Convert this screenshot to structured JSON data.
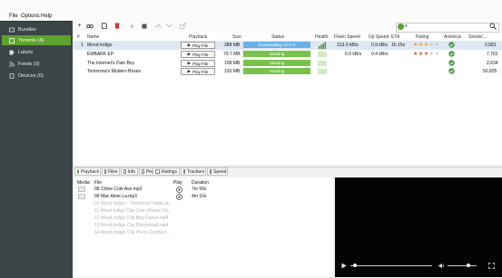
{
  "menu": [
    "File",
    "Options",
    "Help"
  ],
  "sidebar": {
    "items": [
      {
        "label": "Bundles",
        "icon": "bundles-icon",
        "active": false
      },
      {
        "label": "Torrents (4)",
        "icon": "torrents-icon",
        "active": true
      },
      {
        "label": "Labels",
        "icon": "labels-icon",
        "active": false
      },
      {
        "label": "Feeds (0)",
        "icon": "rss-icon",
        "active": false
      },
      {
        "label": "Devices (0)",
        "icon": "devices-icon",
        "active": false
      }
    ]
  },
  "toolbar": {
    "buttons": [
      "add-icon",
      "add-link-icon",
      "create-torrent-icon",
      "remove-icon",
      "start-icon",
      "stop-icon",
      "move-up-icon",
      "move-down-icon",
      "share-icon"
    ],
    "search_placeholder": ""
  },
  "table": {
    "columns": [
      "#",
      "Name",
      "Playback",
      "Size",
      "Status",
      "Health",
      "Down Speed",
      "Up Speed",
      "ETA",
      "Rating",
      "Antivirus",
      "Seeds/..."
    ],
    "play_label": "Play File",
    "rows": [
      {
        "num": "1",
        "name": "Mood Indigo",
        "size": "388 MB",
        "status": "Downloading 13.3 %",
        "down": "313.0 kB/s",
        "up": "0.9 kB/s",
        "eta": "1h 15s",
        "seeds": "2,581",
        "stars": 3,
        "status_type": "downloading"
      },
      {
        "num": "",
        "name": "EMBARK EP",
        "size": "70.7 MB",
        "status": "Seeding",
        "down": "0.0 kB/s",
        "up": "0.4 kB/s",
        "eta": "",
        "seeds": "7,762",
        "stars": 3,
        "status_type": "seeding"
      },
      {
        "num": "",
        "name": "The Internet's Own Boy",
        "size": "158 MB",
        "status": "Seeding",
        "down": "",
        "up": "",
        "eta": "",
        "seeds": "2,634",
        "stars": 0,
        "status_type": "seeding"
      },
      {
        "num": "",
        "name": "Tomorrow's Modern Boxes",
        "size": "120 MB",
        "status": "Seeding",
        "down": "",
        "up": "",
        "eta": "",
        "seeds": "50,825",
        "stars": 0,
        "status_type": "seeding"
      }
    ]
  },
  "detail_tabs": [
    "Playback",
    "Files",
    "Info",
    "Peers",
    "Ratings",
    "Trackers",
    "Speed"
  ],
  "files": {
    "columns": [
      "Media",
      "File",
      "Play",
      "Duration"
    ],
    "rows": [
      {
        "name": "08 Chloe Cole Ave.mp3",
        "duration": "7m 59s",
        "dim": false
      },
      {
        "name": "09 Mac Aime La.mp3",
        "duration": "4m 10s",
        "dim": false
      },
      {
        "name": "01 Mood Indigo - Theatrical Trailer.av...",
        "duration": "",
        "dim": true
      },
      {
        "name": "11 Mood Indigo Clip Colin Meets Chl...",
        "duration": "",
        "dim": true
      },
      {
        "name": "12 Mood Indigo Clip Bop Dance.mp4",
        "duration": "",
        "dim": true
      },
      {
        "name": "13 Mood Indigo Clip Pianocktail.mp4",
        "duration": "",
        "dim": true
      },
      {
        "name": "14 Mood Indigo Clip Pierre Conduct...",
        "duration": "",
        "dim": true
      }
    ]
  },
  "colors": {
    "accent": "#5ea22f",
    "seeding": "#77c24a",
    "downloading": "#6cb1e5",
    "sidebar": "#3a4547"
  }
}
